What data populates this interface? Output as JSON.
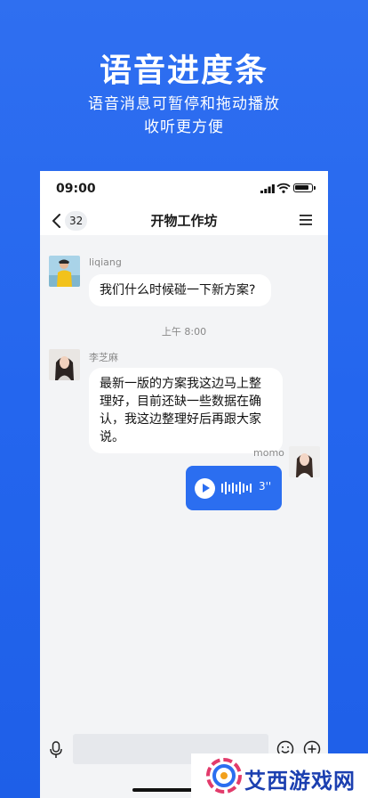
{
  "promo": {
    "title": "语音进度条",
    "subtitle_line1": "语音消息可暂停和拖动播放",
    "subtitle_line2": "收听更方便"
  },
  "status_bar": {
    "time": "09:00"
  },
  "nav": {
    "unread_count": "32",
    "title": "开物工作坊"
  },
  "messages": [
    {
      "sender": "liqiang",
      "text": "我们什么时候碰一下新方案?"
    },
    {
      "time_divider": "上午 8:00"
    },
    {
      "sender": "李芝麻",
      "text": "最新一版的方案我这边马上整理好，目前还缺一些数据在确认，我这边整理好后再跟大家说。"
    },
    {
      "sender": "momo",
      "voice_duration": "3''"
    }
  ],
  "input": {
    "placeholder": ""
  },
  "watermark": {
    "text": "艾西游戏网"
  },
  "colors": {
    "brand_blue": "#2b6ef0",
    "background": "#2466ee"
  },
  "icons": [
    "back-icon",
    "menu-icon",
    "signal-icon",
    "wifi-icon",
    "battery-icon",
    "play-icon",
    "voice-wave-icon",
    "mic-icon",
    "emoji-icon",
    "plus-icon"
  ]
}
